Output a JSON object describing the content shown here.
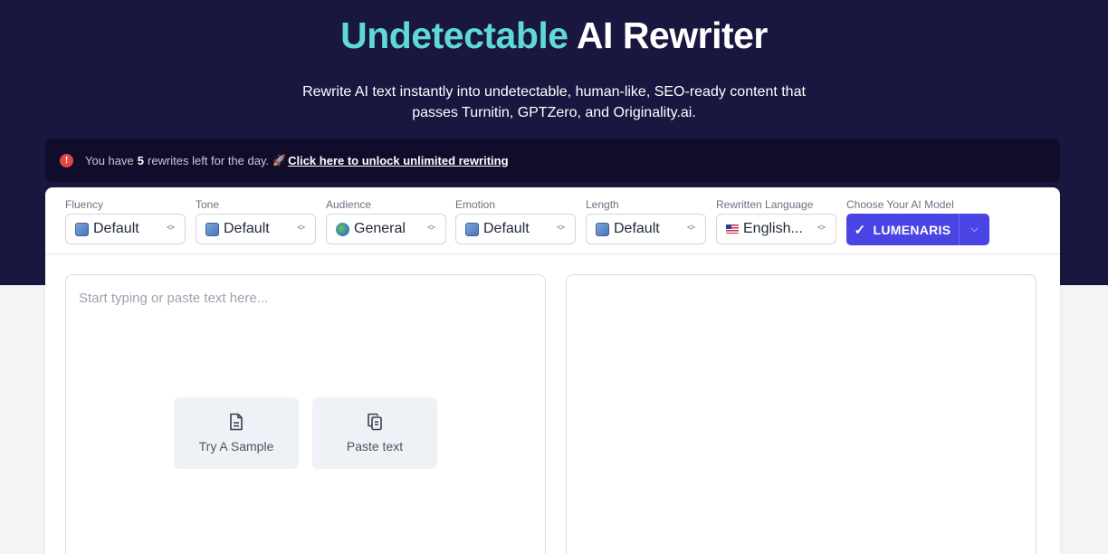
{
  "header": {
    "title_accent": "Undetectable",
    "title_rest": " AI Rewriter",
    "subtitle": "Rewrite AI text instantly into undetectable, human-like, SEO-ready content that passes Turnitin, GPTZero, and Originality.ai."
  },
  "notice": {
    "icon": "info-icon",
    "prefix": "You have",
    "count": "5",
    "suffix": "rewrites left for the day.",
    "rocket": "🚀",
    "link": "Click here to unlock unlimited rewriting"
  },
  "options": [
    {
      "label": "Fluency",
      "value": "Default",
      "icon": "refresh-emoji-icon"
    },
    {
      "label": "Tone",
      "value": "Default",
      "icon": "refresh-emoji-icon"
    },
    {
      "label": "Audience",
      "value": "General",
      "icon": "globe-icon"
    },
    {
      "label": "Emotion",
      "value": "Default",
      "icon": "refresh-emoji-icon"
    },
    {
      "label": "Length",
      "value": "Default",
      "icon": "refresh-emoji-icon"
    },
    {
      "label": "Rewritten Language",
      "value": "English...",
      "icon": "us-flag-icon"
    }
  ],
  "model": {
    "label": "Choose Your AI Model",
    "value": "LUMENARIS",
    "accent_color": "#4b44e5"
  },
  "editor": {
    "placeholder": "Start typing or paste text here...",
    "sample_label": "Try A Sample",
    "paste_label": "Paste text"
  },
  "colors": {
    "hero_bg": "#19163f",
    "title_accent": "#5fd8d6"
  }
}
